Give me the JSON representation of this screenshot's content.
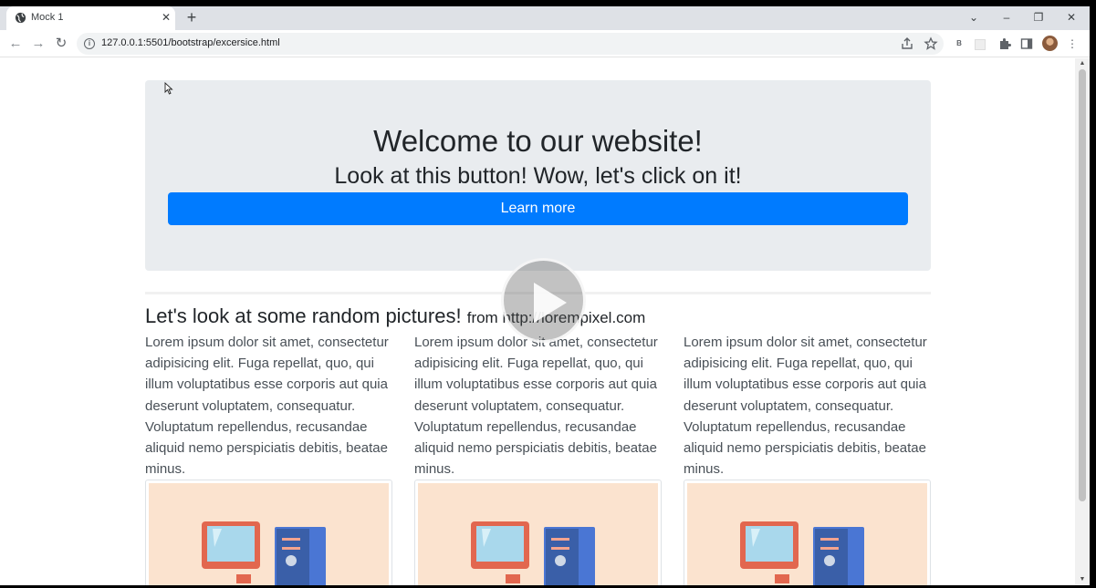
{
  "browser": {
    "tab_title": "Mock 1",
    "tab_close": "✕",
    "new_tab": "+",
    "url": "127.0.0.1:5501/bootstrap/excersice.html",
    "controls": {
      "tab_search": "⌄",
      "minimize": "–",
      "restore": "❐",
      "close": "✕"
    }
  },
  "page": {
    "jumbotron": {
      "title": "Welcome to our website!",
      "subtitle": "Look at this button! Wow, let's click on it!",
      "button": "Learn more"
    },
    "section": {
      "title": "Let's look at some random pictures!",
      "title_small": "from http://lorempixel.com"
    },
    "columns": [
      {
        "text": "Lorem ipsum dolor sit amet, consectetur adipisicing elit. Fuga repellat, quo, qui illum voluptatibus esse corporis aut quia deserunt voluptatem, consequatur. Voluptatum repellendus, recusandae aliquid nemo perspiciatis debitis, beatae minus."
      },
      {
        "text": "Lorem ipsum dolor sit amet, consectetur adipisicing elit. Fuga repellat, quo, qui illum voluptatibus esse corporis aut quia deserunt voluptatem, consequatur. Voluptatum repellendus, recusandae aliquid nemo perspiciatis debitis, beatae minus."
      },
      {
        "text": "Lorem ipsum dolor sit amet, consectetur adipisicing elit. Fuga repellat, quo, qui illum voluptatibus esse corporis aut quia deserunt voluptatem, consequatur. Voluptatum repellendus, recusandae aliquid nemo perspiciatis debitis, beatae minus."
      }
    ]
  },
  "colors": {
    "primary": "#007bff",
    "jumbotron_bg": "#e9ecef",
    "illustration_bg": "#fbe3cf"
  }
}
